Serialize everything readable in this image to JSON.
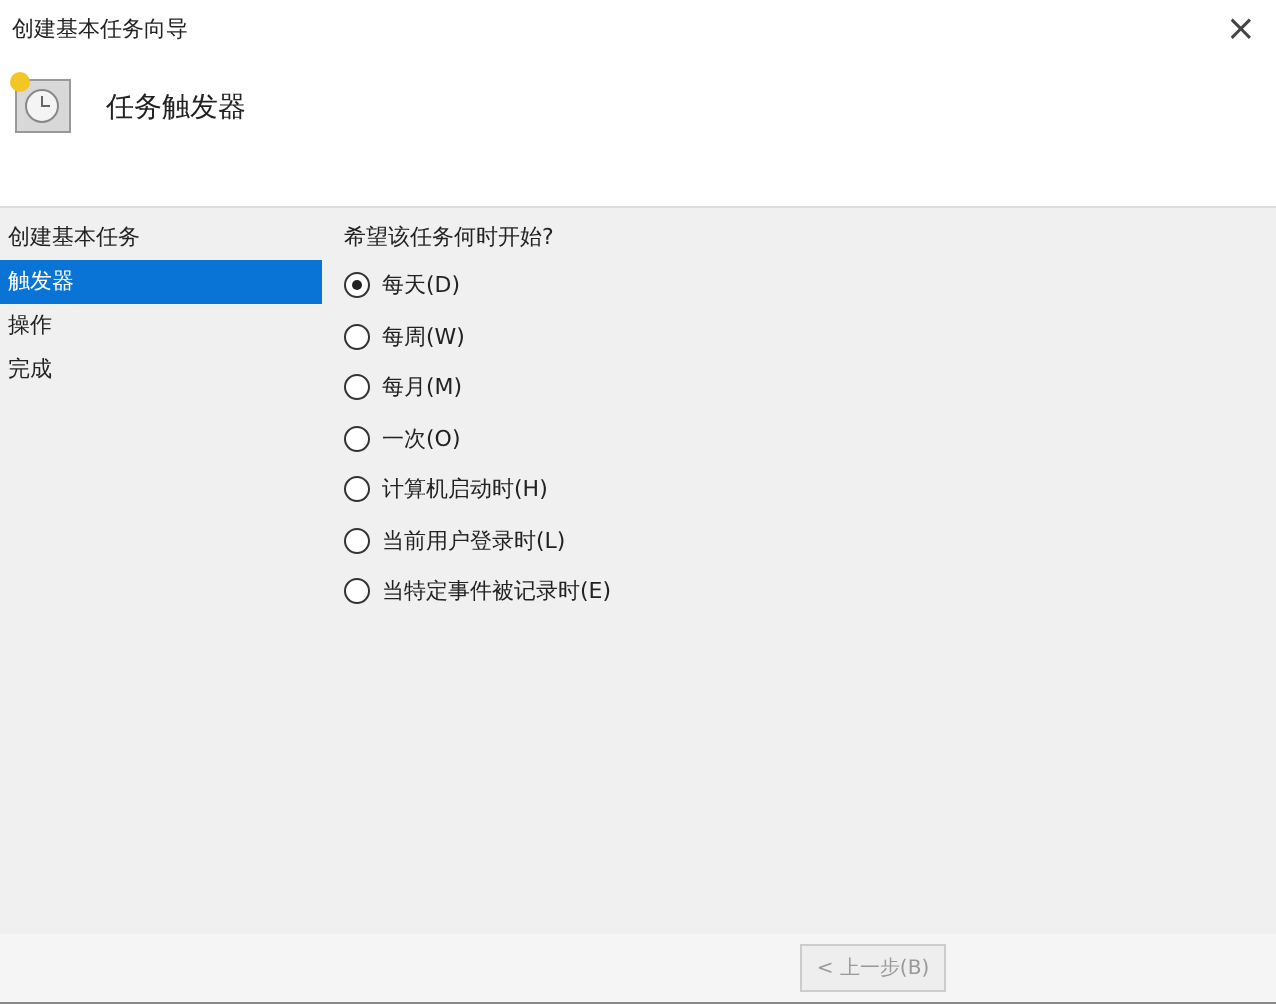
{
  "window": {
    "title": "创建基本任务向导",
    "close": "×"
  },
  "header": {
    "title": "任务触发器"
  },
  "sidebar": {
    "items": [
      {
        "label": "创建基本任务",
        "selected": false
      },
      {
        "label": "触发器",
        "selected": true
      },
      {
        "label": "操作",
        "selected": false
      },
      {
        "label": "完成",
        "selected": false
      }
    ]
  },
  "question": "希望该任务何时开始?",
  "options": [
    {
      "label": "每天(D)",
      "selected": true
    },
    {
      "label": "每周(W)",
      "selected": false
    },
    {
      "label": "每月(M)",
      "selected": false
    },
    {
      "label": "一次(O)",
      "selected": false
    },
    {
      "label": "计算机启动时(H)",
      "selected": false
    },
    {
      "label": "当前用户登录时(L)",
      "selected": false
    },
    {
      "label": "当特定事件被记录时(E)",
      "selected": false
    }
  ],
  "buttons": [
    {
      "label": "< 上一步(B)",
      "disabled": true
    }
  ]
}
